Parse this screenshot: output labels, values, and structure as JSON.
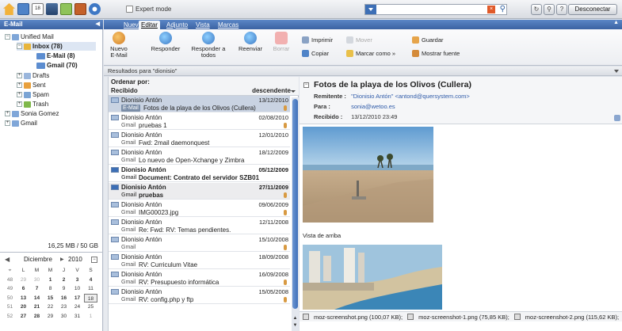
{
  "topbar": {
    "expert_mode_label": "Expert mode",
    "search_value": "",
    "disconnect_label": "Desconectar",
    "icons": [
      "home-icon",
      "mail-icon",
      "calendar-icon",
      "contacts-icon",
      "tasks-icon",
      "infostore-icon",
      "settings-icon"
    ]
  },
  "left": {
    "header": "E-Mail",
    "tree": {
      "unified": "Unified Mail",
      "inbox": "Inbox (78)",
      "email": "E-Mail (8)",
      "gmail": "Gmail (70)",
      "drafts": "Drafts",
      "sent": "Sent",
      "spam": "Spam",
      "trash": "Trash",
      "sonia": "Sonia Gomez",
      "gmail_root": "Gmail"
    },
    "quota": "16,25 MB / 50 GB"
  },
  "calendar": {
    "month": "Diciembre",
    "year": "2010",
    "weekdays": [
      "L",
      "M",
      "M",
      "J",
      "V",
      "S"
    ],
    "weeks": [
      {
        "wk": "48",
        "days": [
          "29",
          "30",
          "1",
          "2",
          "3",
          "4"
        ]
      },
      {
        "wk": "49",
        "days": [
          "6",
          "7",
          "8",
          "9",
          "10",
          "11"
        ]
      },
      {
        "wk": "50",
        "days": [
          "13",
          "14",
          "15",
          "16",
          "17",
          "18"
        ]
      },
      {
        "wk": "51",
        "days": [
          "20",
          "21",
          "22",
          "23",
          "24",
          "25"
        ]
      },
      {
        "wk": "52",
        "days": [
          "27",
          "28",
          "29",
          "30",
          "31",
          "1"
        ]
      }
    ]
  },
  "tabs": [
    "Nuevo",
    "Editar",
    "Adjunto",
    "Vista",
    "Marcas"
  ],
  "ribbon": {
    "new_email": "Nuevo E-Mail",
    "reply": "Responder",
    "reply_all": "Responder a todos",
    "forward": "Reenviar",
    "delete": "Borrar",
    "print": "Imprimir",
    "move": "Mover",
    "save": "Guardar",
    "copy": "Copiar",
    "mark_as": "Marcar como »",
    "show_source": "Mostrar fuente"
  },
  "results_text": "Resultados para \"dionisio\"",
  "list": {
    "order_by": "Ordenar por:",
    "sort_field": "Recibido",
    "sort_dir": "descendente",
    "messages": [
      {
        "from": "Dionisio Antón",
        "date": "13/12/2010",
        "account": "E-Mail",
        "subject": "Fotos de la playa de los Olivos (Cullera)"
      },
      {
        "from": "Dionisio Antón",
        "date": "02/08/2010",
        "account": "Gmail",
        "subject": "pruebas 1"
      },
      {
        "from": "Dionisio Antón",
        "date": "12/01/2010",
        "account": "Gmail",
        "subject": "Fwd: 2mail daemonquest"
      },
      {
        "from": "Dionisio Antón",
        "date": "18/12/2009",
        "account": "Gmail",
        "subject": "Lo nuevo de Open-Xchange y Zimbra"
      },
      {
        "from": "Dionisio Antón",
        "date": "05/12/2009",
        "account": "Gmail",
        "subject": "Document: Contrato del servidor SZB01"
      },
      {
        "from": "Dionisio Antón",
        "date": "27/11/2009",
        "account": "Gmail",
        "subject": "pruebas"
      },
      {
        "from": "Dionisio Antón",
        "date": "09/06/2009",
        "account": "Gmail",
        "subject": "IMG00023.jpg"
      },
      {
        "from": "Dionisio Antón",
        "date": "12/11/2008",
        "account": "Gmail",
        "subject": "Re: Fwd: RV: Temas pendientes."
      },
      {
        "from": "Dionisio Antón",
        "date": "15/10/2008",
        "account": "Gmail",
        "subject": ""
      },
      {
        "from": "Dionisio Antón",
        "date": "18/09/2008",
        "account": "Gmail",
        "subject": "RV: Curriculum Vitae"
      },
      {
        "from": "Dionisio Antón",
        "date": "16/09/2008",
        "account": "Gmail",
        "subject": "RV: Presupuesto informática"
      },
      {
        "from": "Dionisio Antón",
        "date": "15/05/2008",
        "account": "Gmail",
        "subject": "RV: config.php y ftp"
      }
    ]
  },
  "preview": {
    "title": "Fotos de la playa de los Olivos (Cullera)",
    "sender_label": "Remitente :",
    "sender": "\"Dionisio Antón\" <antond@quersystem.com>",
    "to_label": "Para :",
    "to": "sonia@wetoo.es",
    "received_label": "Recibido :",
    "received": "13/12/2010 23:49",
    "caption": "Vista de arriba",
    "attachments": [
      "moz-screenshot.png (100,07 KB);",
      "moz-screenshot-1.png (75,85 KB);",
      "moz-screenshot-2.png (115,62 KB);"
    ]
  }
}
